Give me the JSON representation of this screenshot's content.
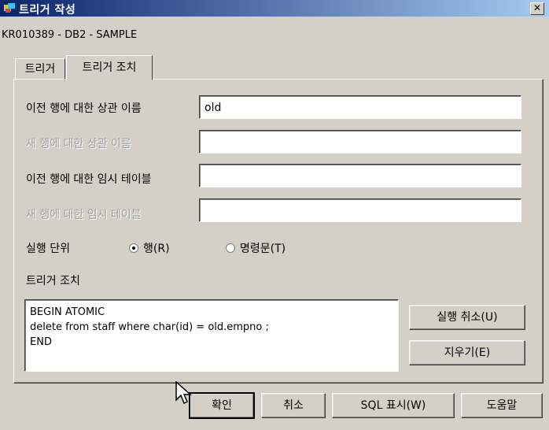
{
  "window": {
    "title": "트리거 작성",
    "close": "✕",
    "connection": "KR010389 - DB2 - SAMPLE"
  },
  "tabs": [
    {
      "label": "트리거",
      "selected": false
    },
    {
      "label": "트리거 조치",
      "selected": true
    }
  ],
  "form": {
    "old_row_label": "이전 행에 대한 상관 이름",
    "old_row_value": "old",
    "new_row_label": "새 행에 대한 상관 이름",
    "new_row_value": "",
    "old_table_label": "이전 행에 대한 임시 테이블",
    "old_table_value": "",
    "new_table_label": "새 행에 대한 임시 테이블",
    "new_table_value": "",
    "granularity_label": "실행 단위",
    "granularity_options": [
      "행(R)",
      "명령문(T)"
    ],
    "granularity_selected": "행(R)",
    "action_label": "트리거 조치",
    "action_lines": [
      "BEGIN ATOMIC",
      "delete from staff where char(id) = old.empno ;",
      "END"
    ]
  },
  "side_buttons": {
    "undo": "실행 취소(U)",
    "clear": "지우기(E)"
  },
  "footer_buttons": {
    "ok": "확인",
    "cancel": "취소",
    "show_sql": "SQL 표시(W)",
    "help": "도움말"
  }
}
